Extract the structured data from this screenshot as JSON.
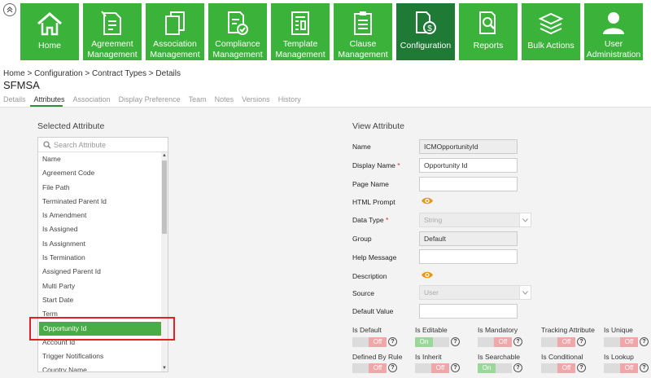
{
  "nav": {
    "tiles": [
      {
        "label": "Home",
        "icon": "home-icon",
        "active": false
      },
      {
        "label": "Agreement\nManagement",
        "icon": "agreement-icon",
        "active": false
      },
      {
        "label": "Association\nManagement",
        "icon": "association-icon",
        "active": false
      },
      {
        "label": "Compliance\nManagement",
        "icon": "compliance-icon",
        "active": false
      },
      {
        "label": "Template\nManagement",
        "icon": "template-icon",
        "active": false
      },
      {
        "label": "Clause\nManagement",
        "icon": "clause-icon",
        "active": false
      },
      {
        "label": "Configuration",
        "icon": "configuration-icon",
        "active": true
      },
      {
        "label": "Reports",
        "icon": "reports-icon",
        "active": false
      },
      {
        "label": "Bulk Actions",
        "icon": "bulk-actions-icon",
        "active": false
      },
      {
        "label": "User\nAdministration",
        "icon": "user-admin-icon",
        "active": false
      }
    ]
  },
  "breadcrumb": {
    "text": "Home  > Configuration  > Contract Types  > Details"
  },
  "page": {
    "title": "SFMSA"
  },
  "tabs": [
    "Details",
    "Attributes",
    "Association",
    "Display Preference",
    "Team",
    "Notes",
    "Versions",
    "History"
  ],
  "left": {
    "title": "Selected Attribute",
    "search_placeholder": "Search Attribute",
    "items": [
      "Name",
      "Agreement Code",
      "File Path",
      "Terminated Parent Id",
      "Is Amendment",
      "Is Assigned",
      "Is Assignment",
      "Is Termination",
      "Assigned Parent Id",
      "Multi Party",
      "Start Date",
      "Term",
      "Opportunity Id",
      "Account Id",
      "Trigger Notifications",
      "Country Name"
    ],
    "selected": "Opportunity Id"
  },
  "right": {
    "title": "View  Attribute",
    "name_label": "Name",
    "name_value": "ICMOpportunityId",
    "display_name_label": "Display Name",
    "display_name_value": "Opportunity Id",
    "page_name_label": "Page Name",
    "page_name_value": "",
    "html_prompt_label": "HTML Prompt",
    "data_type_label": "Data Type",
    "data_type_value": "String",
    "group_label": "Group",
    "group_value": "Default",
    "help_message_label": "Help Message",
    "help_message_value": "",
    "description_label": "Description",
    "source_label": "Source",
    "source_value": "User",
    "default_value_label": "Default Value",
    "default_value_value": "",
    "required_mark": "*"
  },
  "toggles": [
    {
      "label": "Is Default",
      "state": "Off"
    },
    {
      "label": "Is Editable",
      "state": "On"
    },
    {
      "label": "Is Mandatory",
      "state": "Off"
    },
    {
      "label": "Tracking Attribute",
      "state": "Off"
    },
    {
      "label": "Is Unique",
      "state": "Off"
    },
    {
      "label": "Defined By Rule",
      "state": "Off"
    },
    {
      "label": "Is Inherit",
      "state": "Off"
    },
    {
      "label": "Is Searchable",
      "state": "On"
    },
    {
      "label": "Is Conditional",
      "state": "Off"
    },
    {
      "label": "Is Lookup",
      "state": "Off"
    }
  ],
  "help_glyph": "?",
  "colors": {
    "tile": "#3bb33a",
    "tile_active": "#1f7a35",
    "selected_item": "#48ad44",
    "highlight": "#e0212b",
    "eye": "#e39a1b"
  }
}
